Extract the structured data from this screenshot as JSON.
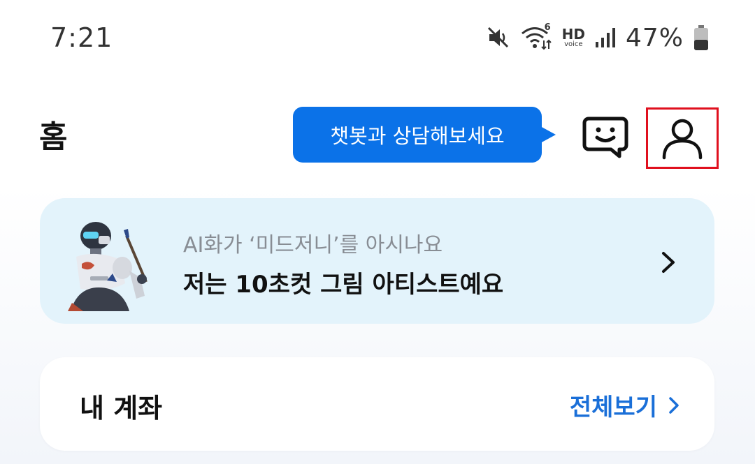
{
  "status_bar": {
    "time": "7:21",
    "battery_percent": "47%",
    "hd_label": "HD",
    "voice_label": "voice",
    "wifi_label": "6",
    "battery_level": 0.47,
    "icons": [
      "mute-icon",
      "wifi-icon",
      "hd-voice-icon",
      "signal-icon",
      "battery-icon"
    ]
  },
  "header": {
    "title": "홈",
    "chat_tooltip": "챗봇과 상담해보세요",
    "chatbot_icon": "chatbot-icon",
    "profile_icon": "profile-icon"
  },
  "promo": {
    "subtitle": "AI화가 ‘미드저니’를 아시나요",
    "title": "저는 10초컷 그림 아티스트예요",
    "chevron": "chevron-right-icon"
  },
  "account": {
    "title": "내 계좌",
    "view_all_label": "전체보기"
  },
  "colors": {
    "accent": "#0b72e8",
    "link": "#1a6fd8",
    "banner_bg": "#e3f3fb",
    "highlight_border": "#e0101e"
  }
}
